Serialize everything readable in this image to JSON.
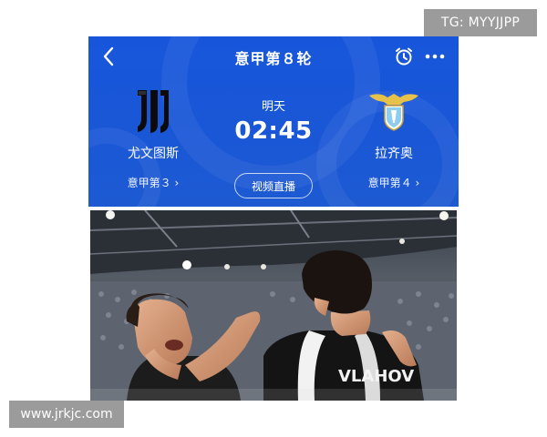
{
  "watermarks": {
    "telegram": "TG: MYYJJPP",
    "site": "www.jrkjc.com"
  },
  "match": {
    "header_title": "意甲第８轮",
    "day_label": "明天",
    "kickoff_time": "02:45",
    "live_button_label": "视频直播",
    "home": {
      "name": "尤文图斯",
      "rank": "意甲第３",
      "logo_icon": "juventus-crest-icon"
    },
    "away": {
      "name": "拉齐奥",
      "rank": "意甲第４",
      "logo_icon": "lazio-eagle-crest-icon"
    },
    "colors": {
      "card_blue": "#1756db",
      "text": "#ffffff"
    }
  },
  "photo": {
    "jersey_text": "VLAHOV"
  }
}
